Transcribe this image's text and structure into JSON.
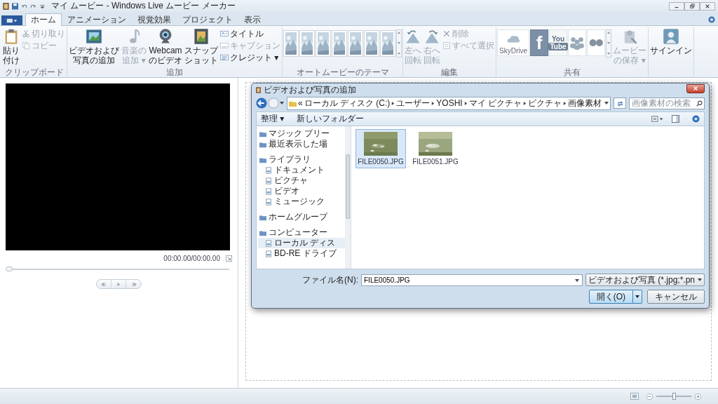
{
  "window": {
    "title": "マイ ムービー - Windows Live ムービー メーカー"
  },
  "tabs": [
    {
      "label": "ホーム",
      "selected": true
    },
    {
      "label": "アニメーション",
      "selected": false
    },
    {
      "label": "視覚効果",
      "selected": false
    },
    {
      "label": "プロジェクト",
      "selected": false
    },
    {
      "label": "表示",
      "selected": false
    }
  ],
  "ribbon": {
    "groups": [
      {
        "label": "クリップボード",
        "items": [
          {
            "kind": "large",
            "lines": [
              "貼り",
              "付け"
            ],
            "disabled": false
          },
          {
            "kind": "small",
            "label": "切り取り",
            "disabled": true
          },
          {
            "kind": "small",
            "label": "コピー",
            "disabled": true
          }
        ]
      },
      {
        "label": "追加",
        "items": [
          {
            "kind": "large",
            "lines": [
              "ビデオおよび",
              "写真の追加"
            ],
            "disabled": false
          },
          {
            "kind": "large",
            "lines": [
              "音楽の",
              "追加 ▾"
            ],
            "disabled": true
          },
          {
            "kind": "large",
            "lines": [
              "Webcam",
              "のビデオ"
            ],
            "disabled": false
          },
          {
            "kind": "large",
            "lines": [
              "スナップ",
              "ショット"
            ],
            "disabled": false
          },
          {
            "kind": "small",
            "label": "タイトル",
            "disabled": false
          },
          {
            "kind": "small",
            "label": "キャプション",
            "disabled": true
          },
          {
            "kind": "small",
            "label": "クレジット ▾",
            "disabled": false
          }
        ]
      },
      {
        "label": "オートムービーのテーマ",
        "items": [
          {
            "kind": "thumb"
          },
          {
            "kind": "thumb"
          },
          {
            "kind": "thumb"
          },
          {
            "kind": "thumb"
          },
          {
            "kind": "thumb"
          },
          {
            "kind": "thumb"
          },
          {
            "kind": "thumb"
          }
        ]
      },
      {
        "label": "編集",
        "items": [
          {
            "kind": "large",
            "lines": [
              "左へ",
              "回転"
            ],
            "disabled": true
          },
          {
            "kind": "large",
            "lines": [
              "右へ",
              "回転"
            ],
            "disabled": true
          },
          {
            "kind": "small",
            "label": "削除",
            "disabled": true
          },
          {
            "kind": "small",
            "label": "すべて選択",
            "disabled": true
          }
        ]
      },
      {
        "label": "共有",
        "items": [
          {
            "kind": "share",
            "label": "SkyDrive"
          },
          {
            "kind": "share",
            "label": "f"
          },
          {
            "kind": "share",
            "lines": [
              "You",
              "Tube"
            ]
          },
          {
            "kind": "share"
          },
          {
            "kind": "share"
          },
          {
            "kind": "large",
            "lines": [
              "ムービー",
              "の保存 ▾"
            ],
            "disabled": true
          }
        ]
      },
      {
        "items": [
          {
            "kind": "large",
            "lines": [
              "サインイン"
            ],
            "disabled": false
          }
        ]
      }
    ]
  },
  "preview": {
    "time": "00:00.00/00:00.00",
    "seek": {
      "level": 0
    }
  },
  "dialog": {
    "title": "ビデオおよび写真の追加",
    "path_prefix": "«",
    "path": [
      "ローカル ディスク (C:)",
      "ユーザー",
      "YOSHI",
      "マイ ピクチャ",
      "ピクチャ",
      "画像素材"
    ],
    "search": {
      "placeholder": "画像素材の検索"
    },
    "toolbar": [
      "整理 ▾",
      "新しいフォルダー"
    ],
    "nav": [
      {
        "label": "マジック ブリー",
        "selected": false
      },
      {
        "label": "最近表示した場",
        "selected": false
      },
      {
        "label": "ライブラリ",
        "selected": false,
        "children": [
          {
            "label": "ドキュメント",
            "selected": false
          },
          {
            "label": "ピクチャ",
            "selected": false
          },
          {
            "label": "ビデオ",
            "selected": false
          },
          {
            "label": "ミュージック",
            "selected": false
          }
        ]
      },
      {
        "label": "ホームグループ",
        "selected": false
      },
      {
        "label": "コンピューター",
        "selected": false,
        "children": [
          {
            "label": "ローカル ディス",
            "selected": true
          },
          {
            "label": "BD-RE ドライブ",
            "selected": false
          }
        ]
      }
    ],
    "files": [
      {
        "name": "FILE0050.JPG",
        "selected": true
      },
      {
        "name": "FILE0051.JPG",
        "selected": false
      }
    ],
    "filename": {
      "label": "ファイル名(N):",
      "value": "FILE0050.JPG"
    },
    "filetype": "ビデオおよび写真 (*.jpg;*.pn",
    "buttons": [
      {
        "label": "開く(O)",
        "kind": "split"
      },
      {
        "label": "キャンセル",
        "kind": "plain"
      }
    ]
  },
  "status_bar": {
    "zoom": {
      "level": 0.5
    }
  }
}
